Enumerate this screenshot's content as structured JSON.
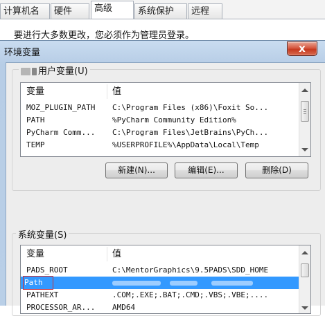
{
  "system_properties": {
    "tabs": [
      {
        "label": "计算机名"
      },
      {
        "label": "硬件"
      },
      {
        "label": "高级",
        "active": true
      },
      {
        "label": "系统保护"
      },
      {
        "label": "远程"
      }
    ],
    "notice": "要进行大多数更改，您必须作为管理员登录。"
  },
  "dialog": {
    "title": "环境变量",
    "close_label": "x",
    "user_vars": {
      "group_label": "用户变量(U)",
      "columns": {
        "name": "变量",
        "value": "值"
      },
      "rows": [
        {
          "name": "MOZ_PLUGIN_PATH",
          "value": "C:\\Program Files (x86)\\Foxit So..."
        },
        {
          "name": "PATH",
          "value": "%PyCharm Community Edition%"
        },
        {
          "name": "PyCharm Comm...",
          "value": "C:\\Program Files\\JetBrains\\PyCh..."
        },
        {
          "name": "TEMP",
          "value": "%USERPROFILE%\\AppData\\Local\\Temp"
        }
      ],
      "buttons": {
        "new": "新建(N)...",
        "edit": "编辑(E)...",
        "delete": "删除(D)"
      }
    },
    "system_vars": {
      "group_label": "系统变量(S)",
      "columns": {
        "name": "变量",
        "value": "值"
      },
      "rows": [
        {
          "name": "PADS_ROOT",
          "value": "C:\\MentorGraphics\\9.5PADS\\SDD_HOME"
        },
        {
          "name": "Path",
          "value": "",
          "selected": true
        },
        {
          "name": "PATHEXT",
          "value": ".COM;.EXE;.BAT;.CMD;.VBS;.VBE;...."
        },
        {
          "name": "PROCESSOR_AR...",
          "value": "AMD64"
        }
      ]
    }
  }
}
